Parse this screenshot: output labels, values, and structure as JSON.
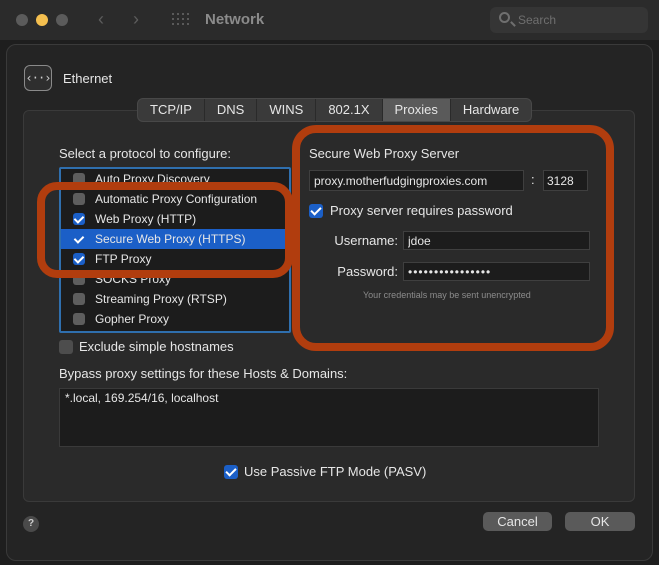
{
  "window": {
    "title": "Network",
    "search_placeholder": "Search",
    "nav_back": "‹",
    "nav_forward": "›"
  },
  "interface": {
    "name": "Ethernet",
    "icon": "‹··›"
  },
  "tabs": [
    "TCP/IP",
    "DNS",
    "WINS",
    "802.1X",
    "Proxies",
    "Hardware"
  ],
  "active_tab": "Proxies",
  "protocols": {
    "label": "Select a protocol to configure:",
    "items": [
      {
        "label": "Auto Proxy Discovery",
        "checked": false,
        "selected": false
      },
      {
        "label": "Automatic Proxy Configuration",
        "checked": false,
        "selected": false
      },
      {
        "label": "Web Proxy (HTTP)",
        "checked": true,
        "selected": false
      },
      {
        "label": "Secure Web Proxy (HTTPS)",
        "checked": true,
        "selected": true
      },
      {
        "label": "FTP Proxy",
        "checked": true,
        "selected": false
      },
      {
        "label": "SOCKS Proxy",
        "checked": false,
        "selected": false
      },
      {
        "label": "Streaming Proxy (RTSP)",
        "checked": false,
        "selected": false
      },
      {
        "label": "Gopher Proxy",
        "checked": false,
        "selected": false
      }
    ]
  },
  "server": {
    "title": "Secure Web Proxy Server",
    "host": "proxy.motherfudgingproxies.com",
    "colon": ":",
    "port": "3128",
    "requires_password_label": "Proxy server requires password",
    "username_label": "Username:",
    "username": "jdoe",
    "password_label": "Password:",
    "password": "••••••••••••••••",
    "hint": "Your credentials may be sent unencrypted"
  },
  "exclude_simple_label": "Exclude simple hostnames",
  "bypass": {
    "label": "Bypass proxy settings for these Hosts & Domains:",
    "value": "*.local, 169.254/16, localhost"
  },
  "pasv_label": "Use Passive FTP Mode (PASV)",
  "help": "?",
  "buttons": {
    "cancel": "Cancel",
    "ok": "OK"
  },
  "colors": {
    "accent": "#1b5fc7",
    "annotation": "#b13d0e"
  }
}
